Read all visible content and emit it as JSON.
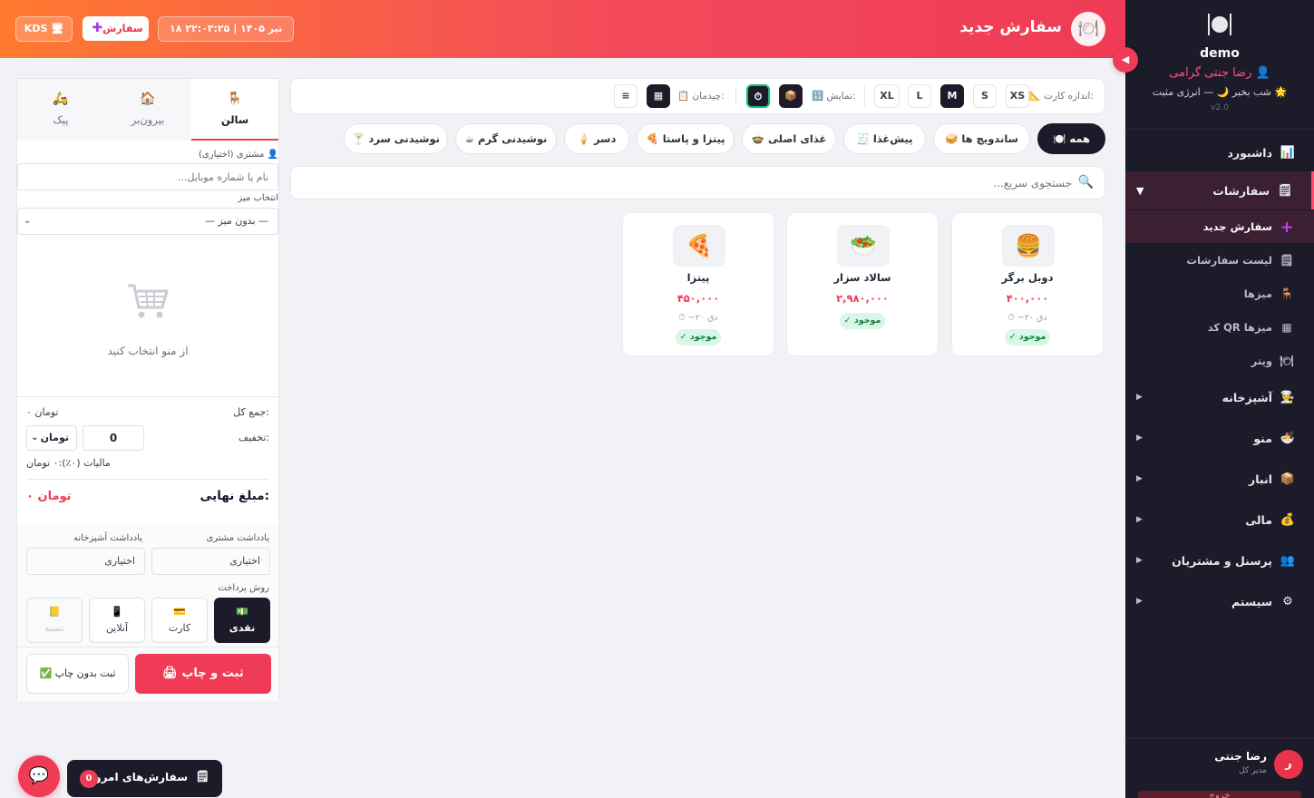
{
  "header": {
    "title": "سفارش جدید",
    "datetime": "۱۸ تیر ۱۴۰۵ | ۲۲:۰۳:۲۵",
    "new_order_label": "سفارش",
    "kds_label": "KDS"
  },
  "sidebar": {
    "brand": "demo",
    "user_greeting": "رضا جنتی گرامی",
    "status": "شب بخیر 🌙 — انرژی مثبت 🌟",
    "version": "v2.0",
    "items": [
      {
        "label": "داشبورد",
        "icon": "chart-icon"
      },
      {
        "label": "سفارشات",
        "icon": "orders-icon"
      },
      {
        "label": "آشپزخانه",
        "icon": "chef-icon"
      },
      {
        "label": "منو",
        "icon": "menu-bowl-icon"
      },
      {
        "label": "انبار",
        "icon": "box-icon"
      },
      {
        "label": "مالی",
        "icon": "money-bag-icon"
      },
      {
        "label": "پرسنل و مشتریان",
        "icon": "people-icon"
      },
      {
        "label": "سیستم",
        "icon": "gear-icon"
      }
    ],
    "sub_items": [
      {
        "label": "سفارش جدید",
        "icon": "plus-icon"
      },
      {
        "label": "لیست سفارشات",
        "icon": "list-icon"
      },
      {
        "label": "میزها",
        "icon": "chair-icon"
      },
      {
        "label": "کد QR میزها",
        "icon": "qr-icon"
      },
      {
        "label": "ویتر",
        "icon": "waiter-icon"
      }
    ],
    "footer": {
      "avatar_letter": "ر",
      "name": "رضا جنتی",
      "role": "مدیر کل",
      "logout": "خروج"
    }
  },
  "toolbar": {
    "card_size_label": "اندازه کارت:",
    "sizes": [
      "XS",
      "S",
      "M",
      "L",
      "XL"
    ],
    "selected_size": "M",
    "display_label": "نمایش:",
    "layout_label": "چیدمان:"
  },
  "categories": [
    {
      "label": "همه",
      "icon": "🍽️"
    },
    {
      "label": "ساندویچ ها",
      "icon": "🥪"
    },
    {
      "label": "پیش‌غذا",
      "icon": "🧾"
    },
    {
      "label": "غذای اصلی",
      "icon": "🍲"
    },
    {
      "label": "پیتزا و پاستا",
      "icon": "🍕"
    },
    {
      "label": "دسر",
      "icon": "🍦"
    },
    {
      "label": "نوشیدنی گرم",
      "icon": "☕"
    },
    {
      "label": "نوشیدنی سرد",
      "icon": "🍸"
    }
  ],
  "search": {
    "placeholder": "جستجوی سریع..."
  },
  "products": [
    {
      "name": "دوبل برگر",
      "price": "۴۰۰,۰۰۰",
      "time": "⏱ ~۲۰ دق",
      "stock": "✓ موجود",
      "emoji": "🍔"
    },
    {
      "name": "سالاد سزار",
      "price": "۲,۹۸۰,۰۰۰",
      "time": "",
      "stock": "✓ موجود",
      "emoji": "🥗"
    },
    {
      "name": "پیتزا",
      "price": "۴۵۰,۰۰۰",
      "time": "⏱ ~۲۰ دق",
      "stock": "✓ موجود",
      "emoji": "🍕"
    }
  ],
  "order": {
    "tabs": [
      {
        "label": "سالن",
        "icon": "🪑"
      },
      {
        "label": "بیرون‌بر",
        "icon": "🏠"
      },
      {
        "label": "پیک",
        "icon": "🛵"
      }
    ],
    "customer_label": "مشتری (اختیاری)",
    "customer_placeholder": "نام یا شماره موبایل...",
    "table_label": "انتخاب میز",
    "table_value": "— بدون میز —",
    "empty_text": "از منو انتخاب کنید",
    "subtotal_label": "جمع کل:",
    "subtotal_value": "۰ تومان",
    "discount_label": "تخفیف:",
    "discount_value": "0",
    "discount_unit": "تومان",
    "tax_label": "مالیات (۰٪):",
    "tax_value": "۰ تومان",
    "final_label": "مبلغ نهایی:",
    "final_value": "۰ تومان",
    "customer_note_label": "یادداشت مشتری",
    "kitchen_note_label": "یادداشت آشپزخانه",
    "note_placeholder": "اختیاری",
    "payment_label": "روش پرداخت",
    "payments": [
      {
        "label": "نقدی",
        "icon": "💵"
      },
      {
        "label": "کارت",
        "icon": "💳"
      },
      {
        "label": "آنلاین",
        "icon": "📱"
      },
      {
        "label": "نسیه",
        "icon": "📒"
      }
    ],
    "submit_print": "ثبت و چاپ",
    "submit_noprint": "ثبت بدون چاپ"
  },
  "today": {
    "label": "سفارش‌های امروز",
    "count": "0"
  }
}
